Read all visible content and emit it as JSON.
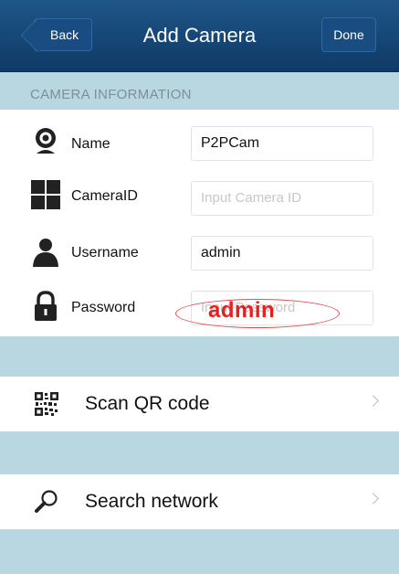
{
  "navbar": {
    "title": "Add Camera",
    "back_label": "Back",
    "done_label": "Done"
  },
  "section": {
    "header": "CAMERA INFORMATION"
  },
  "fields": [
    {
      "label": "Name",
      "icon": "webcam-icon",
      "value": "P2PCam",
      "placeholder": ""
    },
    {
      "label": "CameraID",
      "icon": "grid-icon",
      "value": "",
      "placeholder": "Input Camera ID"
    },
    {
      "label": "Username",
      "icon": "user-icon",
      "value": "admin",
      "placeholder": ""
    },
    {
      "label": "Password",
      "icon": "lock-icon",
      "value": "",
      "placeholder": "Input Password"
    }
  ],
  "annotation": {
    "text": "admin",
    "color": "#e62020"
  },
  "actions": [
    {
      "label": "Scan QR code",
      "icon": "qr-code-icon"
    },
    {
      "label": "Search network",
      "icon": "magnifier-icon"
    }
  ],
  "colors": {
    "navbar": "#0f3a66",
    "background": "#b8d7e1",
    "section_header_text": "#7d8f97"
  }
}
